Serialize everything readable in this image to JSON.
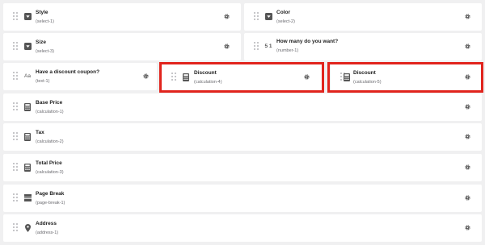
{
  "fields": [
    {
      "title": "Style",
      "subtitle": "(select-1)",
      "icon": "select-icon"
    },
    {
      "title": "Color",
      "subtitle": "(select-2)",
      "icon": "select-icon"
    },
    {
      "title": "Size",
      "subtitle": "(select-3)",
      "icon": "select-icon"
    },
    {
      "title": "How many do you want?",
      "subtitle": "(number-1)",
      "icon": "number-icon"
    },
    {
      "title": "Have a discount coupon?",
      "subtitle": "(text-1)",
      "icon": "text-icon"
    },
    {
      "title": "Discount",
      "subtitle": "(calculation-4)",
      "icon": "calculator-icon"
    },
    {
      "title": "Discount",
      "subtitle": "(calculation-5)",
      "icon": "calculator-icon"
    },
    {
      "title": "Base Price",
      "subtitle": "(calculation-1)",
      "icon": "calculator-icon"
    },
    {
      "title": "Tax",
      "subtitle": "(calculation-2)",
      "icon": "calculator-icon"
    },
    {
      "title": "Total Price",
      "subtitle": "(calculation-3)",
      "icon": "calculator-icon"
    },
    {
      "title": "Page Break",
      "subtitle": "(page-break-1)",
      "icon": "page-break-icon"
    },
    {
      "title": "Address",
      "subtitle": "(address-1)",
      "icon": "location-pin-icon"
    }
  ],
  "text_icon_glyph": "Aa",
  "number_icon_glyph": "5 1",
  "colors": {
    "highlight": "#e1241d",
    "icon": "#555555",
    "card": "#ffffff",
    "background": "#f0f0f1"
  }
}
